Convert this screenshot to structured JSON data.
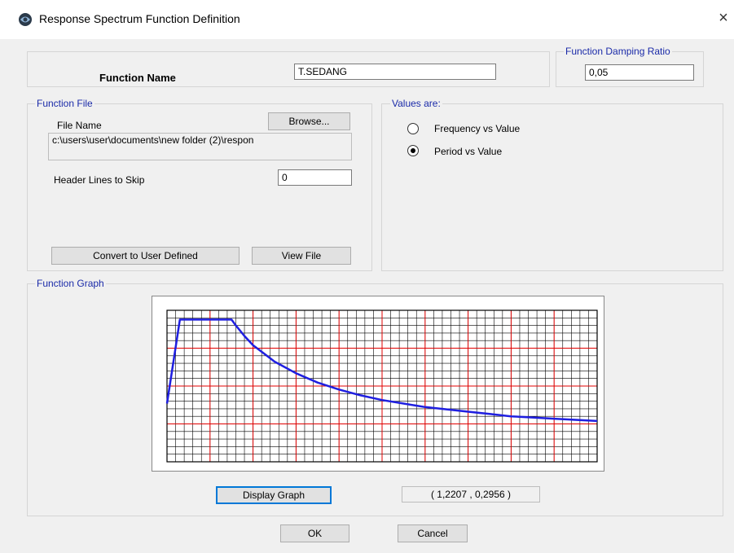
{
  "window": {
    "title": "Response Spectrum  Function Definition",
    "close_symbol": "×"
  },
  "function_name": {
    "label": "Function Name",
    "value": "T.SEDANG"
  },
  "damping": {
    "legend": "Function Damping Ratio",
    "value": "0,05"
  },
  "function_file": {
    "legend": "Function File",
    "file_name_label": "File Name",
    "browse_label": "Browse...",
    "file_path": "c:\\users\\user\\documents\\new folder (2)\\respon",
    "header_lines_label": "Header Lines to Skip",
    "header_lines_value": "0",
    "convert_label": "Convert to User Defined",
    "view_file_label": "View File"
  },
  "values_are": {
    "legend": "Values are:",
    "options": [
      {
        "label": "Frequency vs Value",
        "selected": false
      },
      {
        "label": "Period vs Value",
        "selected": true
      }
    ]
  },
  "graph": {
    "legend": "Function Graph",
    "display_label": "Display Graph",
    "cursor_readout": "( 1,2207  ,  0,2956 )"
  },
  "chart_data": {
    "type": "line",
    "title": "",
    "xlabel": "",
    "ylabel": "",
    "grid": true,
    "series": [
      {
        "color": "#1f1fe0",
        "x": [
          0,
          0.06,
          0.3,
          0.32,
          0.36,
          0.4,
          0.45,
          0.5,
          0.6,
          0.7,
          0.8,
          0.9,
          1.0,
          1.1,
          1.2,
          1.3,
          1.4,
          1.5,
          1.6,
          1.7,
          1.8,
          1.9,
          2.0
        ],
        "y": [
          0.5,
          1.22,
          1.22,
          1.17,
          1.08,
          1.0,
          0.93,
          0.86,
          0.76,
          0.68,
          0.62,
          0.57,
          0.53,
          0.5,
          0.47,
          0.45,
          0.43,
          0.41,
          0.39,
          0.38,
          0.37,
          0.36,
          0.35
        ]
      }
    ]
  },
  "buttons": {
    "ok": "OK",
    "cancel": "Cancel"
  }
}
